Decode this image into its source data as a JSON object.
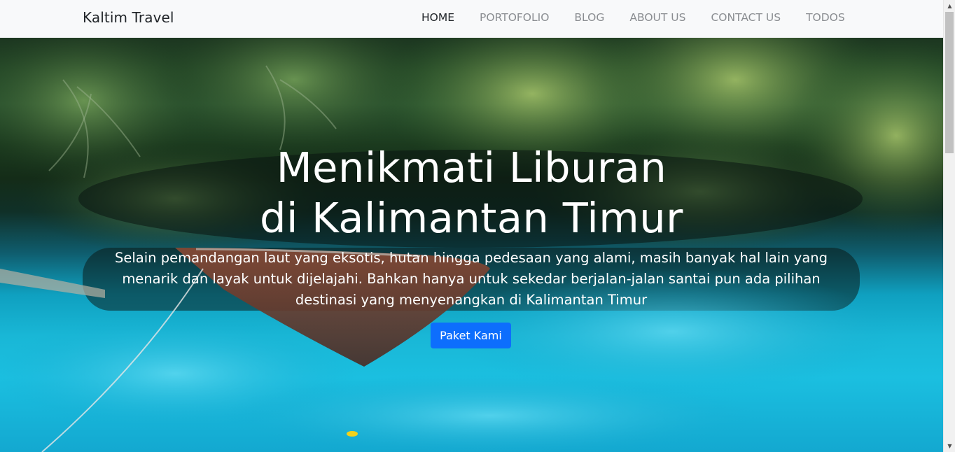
{
  "navbar": {
    "brand": "Kaltim Travel",
    "links": [
      {
        "label": "HOME",
        "active": true
      },
      {
        "label": "PORTOFOLIO",
        "active": false
      },
      {
        "label": "BLOG",
        "active": false
      },
      {
        "label": "ABOUT US",
        "active": false
      },
      {
        "label": "CONTACT US",
        "active": false
      },
      {
        "label": "TODOS",
        "active": false
      }
    ]
  },
  "hero": {
    "title_line1": "Menikmati Liburan",
    "title_line2": "di Kalimantan Timur",
    "description": "Selain pemandangan laut yang eksotis, hutan hingga pedesaan yang alami, masih banyak hal lain yang menarik dan layak untuk dijelajahi. Bahkan hanya untuk sekedar berjalan-jalan santai pun ada pilihan destinasi yang menyenangkan di Kalimantan Timur",
    "button_label": "Paket Kami",
    "background_image": "tropical-lagoon-boat-photo"
  },
  "colors": {
    "navbar_bg": "#f8f9fa",
    "nav_active": "#212529",
    "nav_inactive": "#8a8d91",
    "button_bg": "#0d6efd",
    "text_white": "#ffffff"
  },
  "icons": {
    "scroll_up": "scroll-up-arrow-icon",
    "scroll_down": "scroll-down-arrow-icon"
  }
}
